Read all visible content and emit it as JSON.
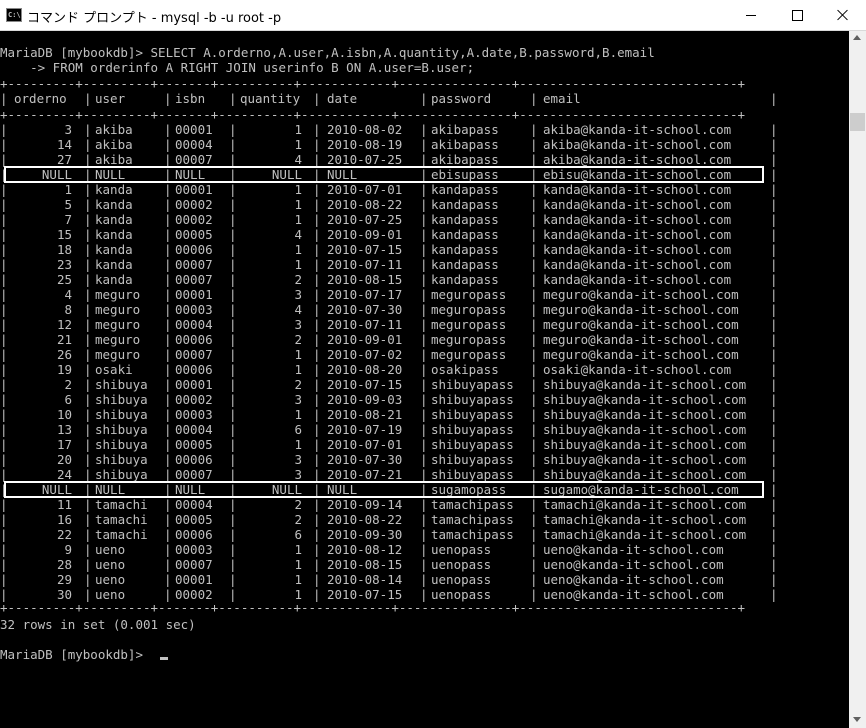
{
  "window": {
    "title": "コマンド プロンプト - mysql  -b -u root -p",
    "icon_text": "C:\\",
    "minimize_icon": "minimize-icon",
    "maximize_icon": "maximize-icon",
    "close_icon": "close-icon"
  },
  "console": {
    "query_line1": "MariaDB [mybookdb]> SELECT A.orderno,A.user,A.isbn,A.quantity,A.date,B.password,B.email",
    "query_line2": "    -> FROM orderinfo A RIGHT JOIN userinfo B ON A.user=B.user;",
    "border": "+---------+---------+-------+----------+------------+---------------+-----------------------------+",
    "columns": [
      "orderno",
      "user",
      "isbn",
      "quantity",
      "date",
      "password",
      "email"
    ],
    "rows": [
      [
        "3",
        "akiba",
        "00001",
        "1",
        "2010-08-02",
        "akibapass",
        "akiba@kanda-it-school.com"
      ],
      [
        "14",
        "akiba",
        "00004",
        "1",
        "2010-08-19",
        "akibapass",
        "akiba@kanda-it-school.com"
      ],
      [
        "27",
        "akiba",
        "00007",
        "4",
        "2010-07-25",
        "akibapass",
        "akiba@kanda-it-school.com"
      ],
      [
        "NULL",
        "NULL",
        "NULL",
        "NULL",
        "NULL",
        "ebisupass",
        "ebisu@kanda-it-school.com"
      ],
      [
        "1",
        "kanda",
        "00001",
        "1",
        "2010-07-01",
        "kandapass",
        "kanda@kanda-it-school.com"
      ],
      [
        "5",
        "kanda",
        "00002",
        "1",
        "2010-08-22",
        "kandapass",
        "kanda@kanda-it-school.com"
      ],
      [
        "7",
        "kanda",
        "00002",
        "1",
        "2010-07-25",
        "kandapass",
        "kanda@kanda-it-school.com"
      ],
      [
        "15",
        "kanda",
        "00005",
        "4",
        "2010-09-01",
        "kandapass",
        "kanda@kanda-it-school.com"
      ],
      [
        "18",
        "kanda",
        "00006",
        "1",
        "2010-07-15",
        "kandapass",
        "kanda@kanda-it-school.com"
      ],
      [
        "23",
        "kanda",
        "00007",
        "1",
        "2010-07-11",
        "kandapass",
        "kanda@kanda-it-school.com"
      ],
      [
        "25",
        "kanda",
        "00007",
        "2",
        "2010-08-15",
        "kandapass",
        "kanda@kanda-it-school.com"
      ],
      [
        "4",
        "meguro",
        "00001",
        "3",
        "2010-07-17",
        "meguropass",
        "meguro@kanda-it-school.com"
      ],
      [
        "8",
        "meguro",
        "00003",
        "4",
        "2010-07-30",
        "meguropass",
        "meguro@kanda-it-school.com"
      ],
      [
        "12",
        "meguro",
        "00004",
        "3",
        "2010-07-11",
        "meguropass",
        "meguro@kanda-it-school.com"
      ],
      [
        "21",
        "meguro",
        "00006",
        "2",
        "2010-09-01",
        "meguropass",
        "meguro@kanda-it-school.com"
      ],
      [
        "26",
        "meguro",
        "00007",
        "1",
        "2010-07-02",
        "meguropass",
        "meguro@kanda-it-school.com"
      ],
      [
        "19",
        "osaki",
        "00006",
        "1",
        "2010-08-20",
        "osakipass",
        "osaki@kanda-it-school.com"
      ],
      [
        "2",
        "shibuya",
        "00001",
        "2",
        "2010-07-15",
        "shibuyapass",
        "shibuya@kanda-it-school.com"
      ],
      [
        "6",
        "shibuya",
        "00002",
        "3",
        "2010-09-03",
        "shibuyapass",
        "shibuya@kanda-it-school.com"
      ],
      [
        "10",
        "shibuya",
        "00003",
        "1",
        "2010-08-21",
        "shibuyapass",
        "shibuya@kanda-it-school.com"
      ],
      [
        "13",
        "shibuya",
        "00004",
        "6",
        "2010-07-19",
        "shibuyapass",
        "shibuya@kanda-it-school.com"
      ],
      [
        "17",
        "shibuya",
        "00005",
        "1",
        "2010-07-01",
        "shibuyapass",
        "shibuya@kanda-it-school.com"
      ],
      [
        "20",
        "shibuya",
        "00006",
        "3",
        "2010-07-30",
        "shibuyapass",
        "shibuya@kanda-it-school.com"
      ],
      [
        "24",
        "shibuya",
        "00007",
        "3",
        "2010-07-21",
        "shibuyapass",
        "shibuya@kanda-it-school.com"
      ],
      [
        "NULL",
        "NULL",
        "NULL",
        "NULL",
        "NULL",
        "sugamopass",
        "sugamo@kanda-it-school.com"
      ],
      [
        "11",
        "tamachi",
        "00004",
        "2",
        "2010-09-14",
        "tamachipass",
        "tamachi@kanda-it-school.com"
      ],
      [
        "16",
        "tamachi",
        "00005",
        "2",
        "2010-08-22",
        "tamachipass",
        "tamachi@kanda-it-school.com"
      ],
      [
        "22",
        "tamachi",
        "00006",
        "6",
        "2010-09-30",
        "tamachipass",
        "tamachi@kanda-it-school.com"
      ],
      [
        "9",
        "ueno",
        "00003",
        "1",
        "2010-08-12",
        "uenopass",
        "ueno@kanda-it-school.com"
      ],
      [
        "28",
        "ueno",
        "00007",
        "1",
        "2010-08-15",
        "uenopass",
        "ueno@kanda-it-school.com"
      ],
      [
        "29",
        "ueno",
        "00001",
        "1",
        "2010-08-14",
        "uenopass",
        "ueno@kanda-it-school.com"
      ],
      [
        "30",
        "ueno",
        "00002",
        "1",
        "2010-07-15",
        "uenopass",
        "ueno@kanda-it-school.com"
      ]
    ],
    "highlighted_rows": [
      3,
      24
    ],
    "result_summary": "32 rows in set (0.001 sec)",
    "prompt": "MariaDB [mybookdb]> "
  },
  "colors": {
    "background": "#000000",
    "text": "#c0c0c0",
    "highlight_border": "#ffffff"
  }
}
